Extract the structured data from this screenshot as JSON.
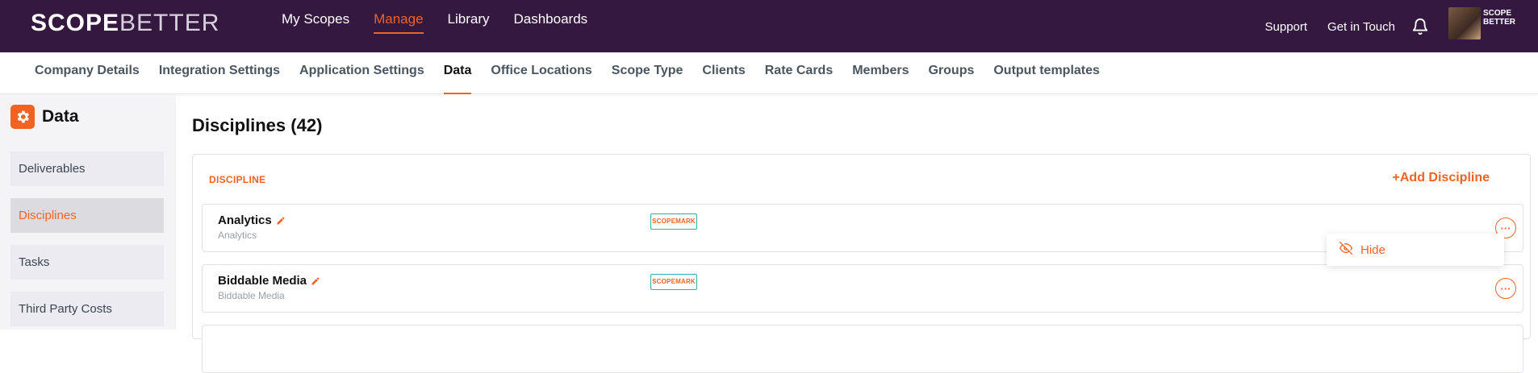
{
  "brand": {
    "logo_bold": "SCOPE",
    "logo_light": "BETTER",
    "mini_logo_top": "SCOPE",
    "mini_logo_bottom": "BETTER",
    "accent": "#f26322",
    "topbar_bg": "#34183f"
  },
  "topnav": [
    {
      "label": "My Scopes",
      "active": false
    },
    {
      "label": "Manage",
      "active": true
    },
    {
      "label": "Library",
      "active": false
    },
    {
      "label": "Dashboards",
      "active": false
    }
  ],
  "topright": {
    "support": "Support",
    "contact": "Get in Touch",
    "bell_icon": "bell-icon"
  },
  "subnav": [
    {
      "label": "Company Details",
      "active": false
    },
    {
      "label": "Integration Settings",
      "active": false
    },
    {
      "label": "Application Settings",
      "active": false
    },
    {
      "label": "Data",
      "active": true
    },
    {
      "label": "Office Locations",
      "active": false
    },
    {
      "label": "Scope Type",
      "active": false
    },
    {
      "label": "Clients",
      "active": false
    },
    {
      "label": "Rate Cards",
      "active": false
    },
    {
      "label": "Members",
      "active": false
    },
    {
      "label": "Groups",
      "active": false
    },
    {
      "label": "Output templates",
      "active": false
    }
  ],
  "sidebar": {
    "title": "Data",
    "icon": "gear-icon",
    "items": [
      {
        "label": "Deliverables",
        "active": false
      },
      {
        "label": "Disciplines",
        "active": true
      },
      {
        "label": "Tasks",
        "active": false
      },
      {
        "label": "Third Party Costs",
        "active": false
      }
    ]
  },
  "main": {
    "title": "Disciplines (42)",
    "column_label": "DISCIPLINE",
    "add_button": "+Add Discipline",
    "rows": [
      {
        "name": "Analytics",
        "subtitle": "Analytics",
        "badge": "SCOPEMARK",
        "more": "···"
      },
      {
        "name": "Biddable Media",
        "subtitle": "Biddable Media",
        "badge": "SCOPEMARK",
        "more": "···"
      }
    ],
    "dropdown": {
      "icon": "eye-off-icon",
      "label": "Hide"
    }
  }
}
